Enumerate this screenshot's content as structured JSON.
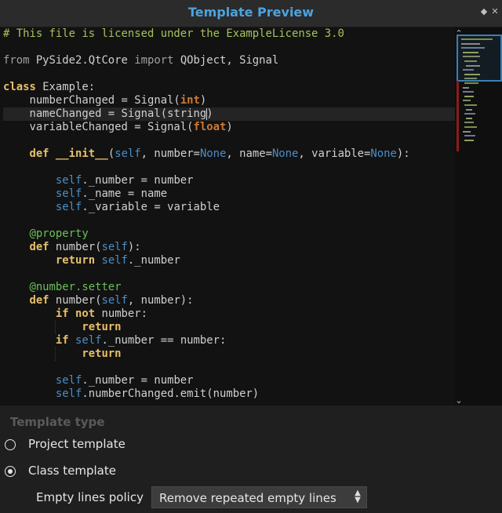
{
  "window": {
    "title": "Template Preview",
    "float_icon": "◆",
    "close_icon": "✕"
  },
  "editor": {
    "lines": [
      [
        {
          "t": "# This file is licensed under the ExampleLicense 3.0",
          "c": "comment"
        }
      ],
      [],
      [
        {
          "t": "from",
          "c": "mod"
        },
        {
          "t": " PySide2.QtCore ",
          "c": "plain"
        },
        {
          "t": "import",
          "c": "mod"
        },
        {
          "t": " QObject, Signal",
          "c": "plain"
        }
      ],
      [],
      [
        {
          "t": "class",
          "c": "kw"
        },
        {
          "t": " Example:",
          "c": "plain"
        }
      ],
      [
        {
          "t": "    numberChanged = Signal(",
          "c": "plain"
        },
        {
          "t": "int",
          "c": "builtin"
        },
        {
          "t": ")",
          "c": "plain"
        }
      ],
      [
        {
          "t": "    nameChanged = Signal(string)",
          "c": "plain"
        }
      ],
      [
        {
          "t": "    variableChanged = Signal(",
          "c": "plain"
        },
        {
          "t": "float",
          "c": "builtin"
        },
        {
          "t": ")",
          "c": "plain"
        }
      ],
      [],
      [
        {
          "t": "    ",
          "c": "plain"
        },
        {
          "t": "def",
          "c": "kw"
        },
        {
          "t": " ",
          "c": "plain"
        },
        {
          "t": "__init__",
          "c": "kw"
        },
        {
          "t": "(",
          "c": "plain"
        },
        {
          "t": "self",
          "c": "self"
        },
        {
          "t": ", number=",
          "c": "plain"
        },
        {
          "t": "None",
          "c": "none"
        },
        {
          "t": ", name=",
          "c": "plain"
        },
        {
          "t": "None",
          "c": "none"
        },
        {
          "t": ", variable=",
          "c": "plain"
        },
        {
          "t": "None",
          "c": "none"
        },
        {
          "t": "):",
          "c": "plain"
        }
      ],
      [],
      [
        {
          "t": "        ",
          "c": "plain"
        },
        {
          "t": "self",
          "c": "self"
        },
        {
          "t": "._number = number",
          "c": "plain"
        }
      ],
      [
        {
          "t": "        ",
          "c": "plain"
        },
        {
          "t": "self",
          "c": "self"
        },
        {
          "t": "._name = name",
          "c": "plain"
        }
      ],
      [
        {
          "t": "        ",
          "c": "plain"
        },
        {
          "t": "self",
          "c": "self"
        },
        {
          "t": "._variable = variable",
          "c": "plain"
        }
      ],
      [],
      [
        {
          "t": "    @property",
          "c": "deco"
        }
      ],
      [
        {
          "t": "    ",
          "c": "plain"
        },
        {
          "t": "def",
          "c": "kw"
        },
        {
          "t": " number(",
          "c": "plain"
        },
        {
          "t": "self",
          "c": "self"
        },
        {
          "t": "):",
          "c": "plain"
        }
      ],
      [
        {
          "t": "        ",
          "c": "plain"
        },
        {
          "t": "return",
          "c": "kw"
        },
        {
          "t": " ",
          "c": "plain"
        },
        {
          "t": "self",
          "c": "self"
        },
        {
          "t": "._number",
          "c": "plain"
        }
      ],
      [],
      [
        {
          "t": "    @number.setter",
          "c": "deco"
        }
      ],
      [
        {
          "t": "    ",
          "c": "plain"
        },
        {
          "t": "def",
          "c": "kw"
        },
        {
          "t": " number(",
          "c": "plain"
        },
        {
          "t": "self",
          "c": "self"
        },
        {
          "t": ", number):",
          "c": "plain"
        }
      ],
      [
        {
          "t": "        ",
          "c": "plain"
        },
        {
          "t": "if",
          "c": "kw"
        },
        {
          "t": " ",
          "c": "plain"
        },
        {
          "t": "not",
          "c": "kw"
        },
        {
          "t": " number:",
          "c": "plain"
        }
      ],
      [
        {
          "t": "            ",
          "c": "plain"
        },
        {
          "t": "return",
          "c": "kw"
        }
      ],
      [
        {
          "t": "        ",
          "c": "plain"
        },
        {
          "t": "if",
          "c": "kw"
        },
        {
          "t": " ",
          "c": "plain"
        },
        {
          "t": "self",
          "c": "self"
        },
        {
          "t": "._number == number:",
          "c": "plain"
        }
      ],
      [
        {
          "t": "            ",
          "c": "plain"
        },
        {
          "t": "return",
          "c": "kw"
        }
      ],
      [],
      [
        {
          "t": "        ",
          "c": "plain"
        },
        {
          "t": "self",
          "c": "self"
        },
        {
          "t": "._number = number",
          "c": "plain"
        }
      ],
      [
        {
          "t": "        ",
          "c": "plain"
        },
        {
          "t": "self",
          "c": "self"
        },
        {
          "t": ".numberChanged.emit(number)",
          "c": "plain"
        }
      ]
    ],
    "current_line": 6,
    "scroll_up_icon": "⌃",
    "scroll_down_icon": "⌄"
  },
  "colors": {
    "comment": "#a5c25c",
    "keyword": "#e8bf6a",
    "builtin": "#cc7833",
    "self": "#4a8ec7",
    "decorator": "#6bbf59",
    "title": "#4ca3dd"
  },
  "options": {
    "section_title": "Template type",
    "radios": [
      {
        "label": "Project template",
        "checked": false
      },
      {
        "label": "Class template",
        "checked": true
      }
    ],
    "empty_lines_label": "Empty lines policy",
    "empty_lines_value": "Remove repeated empty lines"
  }
}
